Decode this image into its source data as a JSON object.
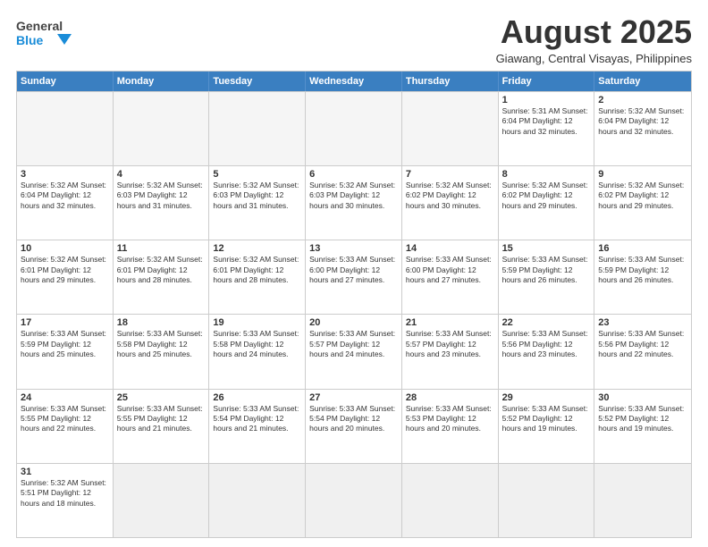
{
  "header": {
    "logo_general": "General",
    "logo_blue": "Blue",
    "month_title": "August 2025",
    "subtitle": "Giawang, Central Visayas, Philippines"
  },
  "days_of_week": [
    "Sunday",
    "Monday",
    "Tuesday",
    "Wednesday",
    "Thursday",
    "Friday",
    "Saturday"
  ],
  "weeks": [
    [
      {
        "day": "",
        "info": ""
      },
      {
        "day": "",
        "info": ""
      },
      {
        "day": "",
        "info": ""
      },
      {
        "day": "",
        "info": ""
      },
      {
        "day": "",
        "info": ""
      },
      {
        "day": "1",
        "info": "Sunrise: 5:31 AM\nSunset: 6:04 PM\nDaylight: 12 hours and 32 minutes."
      },
      {
        "day": "2",
        "info": "Sunrise: 5:32 AM\nSunset: 6:04 PM\nDaylight: 12 hours and 32 minutes."
      }
    ],
    [
      {
        "day": "3",
        "info": "Sunrise: 5:32 AM\nSunset: 6:04 PM\nDaylight: 12 hours and 32 minutes."
      },
      {
        "day": "4",
        "info": "Sunrise: 5:32 AM\nSunset: 6:03 PM\nDaylight: 12 hours and 31 minutes."
      },
      {
        "day": "5",
        "info": "Sunrise: 5:32 AM\nSunset: 6:03 PM\nDaylight: 12 hours and 31 minutes."
      },
      {
        "day": "6",
        "info": "Sunrise: 5:32 AM\nSunset: 6:03 PM\nDaylight: 12 hours and 30 minutes."
      },
      {
        "day": "7",
        "info": "Sunrise: 5:32 AM\nSunset: 6:02 PM\nDaylight: 12 hours and 30 minutes."
      },
      {
        "day": "8",
        "info": "Sunrise: 5:32 AM\nSunset: 6:02 PM\nDaylight: 12 hours and 29 minutes."
      },
      {
        "day": "9",
        "info": "Sunrise: 5:32 AM\nSunset: 6:02 PM\nDaylight: 12 hours and 29 minutes."
      }
    ],
    [
      {
        "day": "10",
        "info": "Sunrise: 5:32 AM\nSunset: 6:01 PM\nDaylight: 12 hours and 29 minutes."
      },
      {
        "day": "11",
        "info": "Sunrise: 5:32 AM\nSunset: 6:01 PM\nDaylight: 12 hours and 28 minutes."
      },
      {
        "day": "12",
        "info": "Sunrise: 5:32 AM\nSunset: 6:01 PM\nDaylight: 12 hours and 28 minutes."
      },
      {
        "day": "13",
        "info": "Sunrise: 5:33 AM\nSunset: 6:00 PM\nDaylight: 12 hours and 27 minutes."
      },
      {
        "day": "14",
        "info": "Sunrise: 5:33 AM\nSunset: 6:00 PM\nDaylight: 12 hours and 27 minutes."
      },
      {
        "day": "15",
        "info": "Sunrise: 5:33 AM\nSunset: 5:59 PM\nDaylight: 12 hours and 26 minutes."
      },
      {
        "day": "16",
        "info": "Sunrise: 5:33 AM\nSunset: 5:59 PM\nDaylight: 12 hours and 26 minutes."
      }
    ],
    [
      {
        "day": "17",
        "info": "Sunrise: 5:33 AM\nSunset: 5:59 PM\nDaylight: 12 hours and 25 minutes."
      },
      {
        "day": "18",
        "info": "Sunrise: 5:33 AM\nSunset: 5:58 PM\nDaylight: 12 hours and 25 minutes."
      },
      {
        "day": "19",
        "info": "Sunrise: 5:33 AM\nSunset: 5:58 PM\nDaylight: 12 hours and 24 minutes."
      },
      {
        "day": "20",
        "info": "Sunrise: 5:33 AM\nSunset: 5:57 PM\nDaylight: 12 hours and 24 minutes."
      },
      {
        "day": "21",
        "info": "Sunrise: 5:33 AM\nSunset: 5:57 PM\nDaylight: 12 hours and 23 minutes."
      },
      {
        "day": "22",
        "info": "Sunrise: 5:33 AM\nSunset: 5:56 PM\nDaylight: 12 hours and 23 minutes."
      },
      {
        "day": "23",
        "info": "Sunrise: 5:33 AM\nSunset: 5:56 PM\nDaylight: 12 hours and 22 minutes."
      }
    ],
    [
      {
        "day": "24",
        "info": "Sunrise: 5:33 AM\nSunset: 5:55 PM\nDaylight: 12 hours and 22 minutes."
      },
      {
        "day": "25",
        "info": "Sunrise: 5:33 AM\nSunset: 5:55 PM\nDaylight: 12 hours and 21 minutes."
      },
      {
        "day": "26",
        "info": "Sunrise: 5:33 AM\nSunset: 5:54 PM\nDaylight: 12 hours and 21 minutes."
      },
      {
        "day": "27",
        "info": "Sunrise: 5:33 AM\nSunset: 5:54 PM\nDaylight: 12 hours and 20 minutes."
      },
      {
        "day": "28",
        "info": "Sunrise: 5:33 AM\nSunset: 5:53 PM\nDaylight: 12 hours and 20 minutes."
      },
      {
        "day": "29",
        "info": "Sunrise: 5:33 AM\nSunset: 5:52 PM\nDaylight: 12 hours and 19 minutes."
      },
      {
        "day": "30",
        "info": "Sunrise: 5:33 AM\nSunset: 5:52 PM\nDaylight: 12 hours and 19 minutes."
      }
    ],
    [
      {
        "day": "31",
        "info": "Sunrise: 5:32 AM\nSunset: 5:51 PM\nDaylight: 12 hours and 18 minutes."
      },
      {
        "day": "",
        "info": ""
      },
      {
        "day": "",
        "info": ""
      },
      {
        "day": "",
        "info": ""
      },
      {
        "day": "",
        "info": ""
      },
      {
        "day": "",
        "info": ""
      },
      {
        "day": "",
        "info": ""
      }
    ]
  ]
}
